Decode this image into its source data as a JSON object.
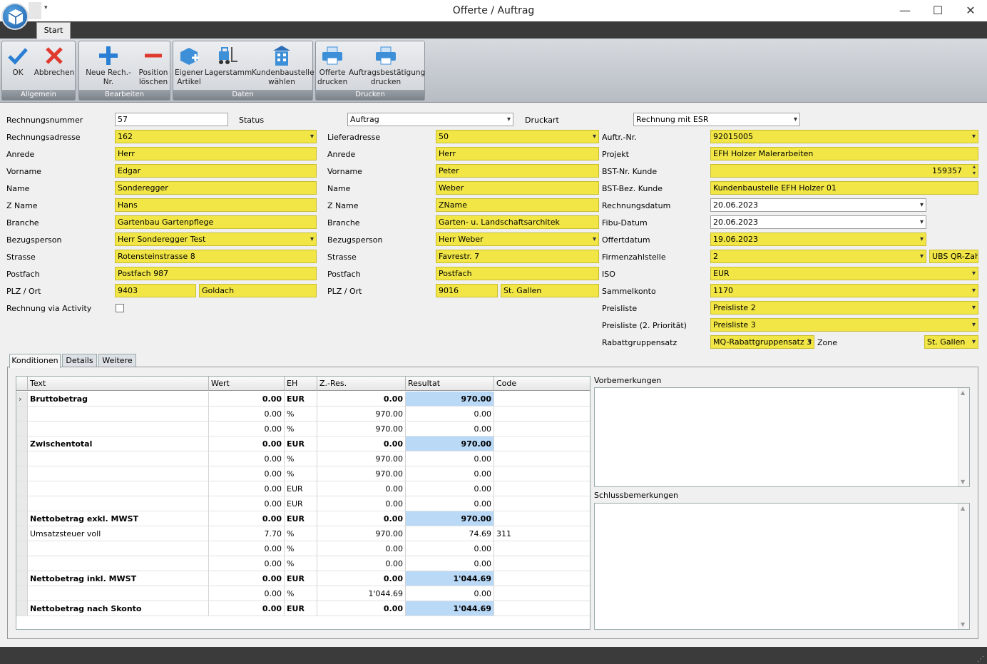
{
  "window": {
    "title": "Offerte / Auftrag",
    "tab": "Start"
  },
  "ribbon": {
    "groups": [
      {
        "label": "Allgemein",
        "buttons": [
          "OK",
          "Abbrechen"
        ]
      },
      {
        "label": "Bearbeiten",
        "buttons": [
          "Neue Rech.-Nr.",
          "Position löschen"
        ]
      },
      {
        "label": "Daten",
        "buttons": [
          "Eigener Artikel",
          "Lagerstamm",
          "Kundenbaustelle wählen"
        ]
      },
      {
        "label": "Drucken",
        "buttons": [
          "Offerte drucken",
          "Auftragsbestätigung drucken"
        ]
      }
    ]
  },
  "form": {
    "rechnungsnummer_label": "Rechnungsnummer",
    "rechnungsnummer": "57",
    "status_label": "Status",
    "status": "Auftrag",
    "druckart_label": "Druckart",
    "druckart": "Rechnung mit ESR",
    "rech": {
      "labels": [
        "Rechnungsadresse",
        "Anrede",
        "Vorname",
        "Name",
        "Z Name",
        "Branche",
        "Bezugsperson",
        "Strasse",
        "Postfach",
        "PLZ / Ort"
      ],
      "adresse": "162",
      "anrede": "Herr",
      "vorname": "Edgar",
      "name": "Sonderegger",
      "zname": "Hans",
      "branche": "Gartenbau Gartenpflege",
      "bezugsperson": "Herr Sonderegger Test",
      "strasse": "Rotensteinstrasse 8",
      "postfach": "Postfach 987",
      "plz": "9403",
      "ort": "Goldach"
    },
    "activity_label": "Rechnung via Activity",
    "lief": {
      "labels": [
        "Lieferadresse",
        "Anrede",
        "Vorname",
        "Name",
        "Z Name",
        "Branche",
        "Bezugsperson",
        "Strasse",
        "Postfach",
        "PLZ / Ort"
      ],
      "adresse": "50",
      "anrede": "Herr",
      "vorname": "Peter",
      "name": "Weber",
      "zname": "ZName",
      "branche": "Garten- u. Landschaftsarchitek",
      "bezugsperson": "Herr Weber",
      "strasse": "Favrestr. 7",
      "postfach": "Postfach",
      "plz": "9016",
      "ort": "St. Gallen"
    },
    "right": {
      "labels": [
        "Auftr.-Nr.",
        "Projekt",
        "BST-Nr. Kunde",
        "BST-Bez. Kunde",
        "Rechnungsdatum",
        "Fibu-Datum",
        "Offertdatum",
        "Firmenzahlstelle",
        "ISO",
        "Sammelkonto",
        "Preisliste",
        "Preisliste (2. Priorität)",
        "Rabattgruppensatz"
      ],
      "auftrnr": "92015005",
      "projekt": "EFH Holzer Malerarbeiten",
      "bstnr": "159357",
      "bstbez": "Kundenbaustelle EFH Holzer 01",
      "rechnungsdatum": "20.06.2023",
      "fibudatum": "20.06.2023",
      "offertdatum": "19.06.2023",
      "firmenzahlstelle": "2",
      "qr": "UBS QR-Zahl",
      "iso": "EUR",
      "sammelkonto": "1170",
      "preisliste": "Preisliste 2",
      "preisliste2": "Preisliste 3",
      "rabatt": "MQ-Rabattgruppensatz  3",
      "zone_label": "Zone",
      "zone": "St. Gallen"
    }
  },
  "tabs": [
    "Konditionen",
    "Details",
    "Weitere"
  ],
  "grid": {
    "headers": [
      "Text",
      "Wert",
      "EH",
      "Z.-Res.",
      "Resultat",
      "Code"
    ],
    "rows": [
      {
        "text": "Bruttobetrag",
        "wert": "0.00",
        "eh": "EUR",
        "zres": "0.00",
        "resultat": "970.00",
        "code": "",
        "bold": true
      },
      {
        "text": "",
        "wert": "0.00",
        "eh": "%",
        "zres": "970.00",
        "resultat": "0.00",
        "code": "",
        "bold": false
      },
      {
        "text": "",
        "wert": "0.00",
        "eh": "%",
        "zres": "970.00",
        "resultat": "0.00",
        "code": "",
        "bold": false
      },
      {
        "text": "Zwischentotal",
        "wert": "0.00",
        "eh": "EUR",
        "zres": "0.00",
        "resultat": "970.00",
        "code": "",
        "bold": true
      },
      {
        "text": "",
        "wert": "0.00",
        "eh": "%",
        "zres": "970.00",
        "resultat": "0.00",
        "code": "",
        "bold": false
      },
      {
        "text": "",
        "wert": "0.00",
        "eh": "%",
        "zres": "970.00",
        "resultat": "0.00",
        "code": "",
        "bold": false
      },
      {
        "text": "",
        "wert": "0.00",
        "eh": "EUR",
        "zres": "0.00",
        "resultat": "0.00",
        "code": "",
        "bold": false
      },
      {
        "text": "",
        "wert": "0.00",
        "eh": "EUR",
        "zres": "0.00",
        "resultat": "0.00",
        "code": "",
        "bold": false
      },
      {
        "text": "Nettobetrag exkl. MWST",
        "wert": "0.00",
        "eh": "EUR",
        "zres": "0.00",
        "resultat": "970.00",
        "code": "",
        "bold": true
      },
      {
        "text": "Umsatzsteuer voll",
        "wert": "7.70",
        "eh": "%",
        "zres": "970.00",
        "resultat": "74.69",
        "code": "311",
        "bold": false
      },
      {
        "text": "",
        "wert": "0.00",
        "eh": "%",
        "zres": "0.00",
        "resultat": "0.00",
        "code": "",
        "bold": false
      },
      {
        "text": "",
        "wert": "0.00",
        "eh": "%",
        "zres": "0.00",
        "resultat": "0.00",
        "code": "",
        "bold": false
      },
      {
        "text": "Nettobetrag inkl. MWST",
        "wert": "0.00",
        "eh": "EUR",
        "zres": "0.00",
        "resultat": "1'044.69",
        "code": "",
        "bold": true
      },
      {
        "text": "",
        "wert": "0.00",
        "eh": "%",
        "zres": "1'044.69",
        "resultat": "0.00",
        "code": "",
        "bold": false
      },
      {
        "text": "Nettobetrag nach Skonto",
        "wert": "0.00",
        "eh": "EUR",
        "zres": "0.00",
        "resultat": "1'044.69",
        "code": "",
        "bold": true
      }
    ]
  },
  "memos": {
    "vor_label": "Vorbemerkungen",
    "schluss_label": "Schlussbemerkungen"
  },
  "colors": {
    "required": "#f1e646",
    "result": "#b9d9f7",
    "ribbon_label": "#7c828a"
  }
}
